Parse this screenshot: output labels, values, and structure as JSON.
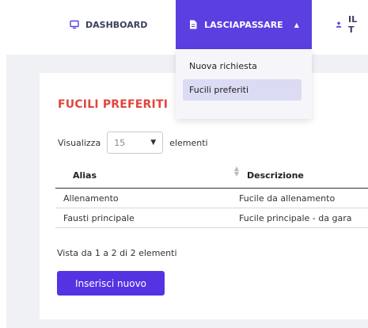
{
  "navbar": {
    "dashboard_label": "DASHBOARD",
    "lasciapassare_label": "LASCIAPASSARE",
    "user_label": "IL T",
    "active_color": "#5b3fe0"
  },
  "dropdown": {
    "items": [
      {
        "label": "Nuova richiesta"
      },
      {
        "label": "Fucili preferiti"
      }
    ]
  },
  "card": {
    "title": "FUCILI PREFERITI",
    "show_prefix": "Visualizza",
    "show_value": "15",
    "show_suffix": "elementi",
    "table": {
      "headers": [
        "Alias",
        "Descrizione"
      ],
      "rows": [
        {
          "alias": "Allenamento",
          "descrizione": "Fucile da allenamento"
        },
        {
          "alias": "Fausti principale",
          "descrizione": "Fucile principale - da gara"
        }
      ]
    },
    "info_text": "Vista da 1 a 2 di 2 elementi",
    "new_button_label": "Inserisci nuovo"
  },
  "icons": {
    "dashboard": "monitor-icon",
    "lasciapassare": "document-icon",
    "user": "user-icon",
    "caret": "caret-up-icon",
    "select_chevron": "chevron-down-icon",
    "sort": "sort-icon"
  },
  "colors": {
    "title_red": "#e0463e",
    "primary": "#5533e3",
    "page_bg": "#f0f1f5"
  }
}
